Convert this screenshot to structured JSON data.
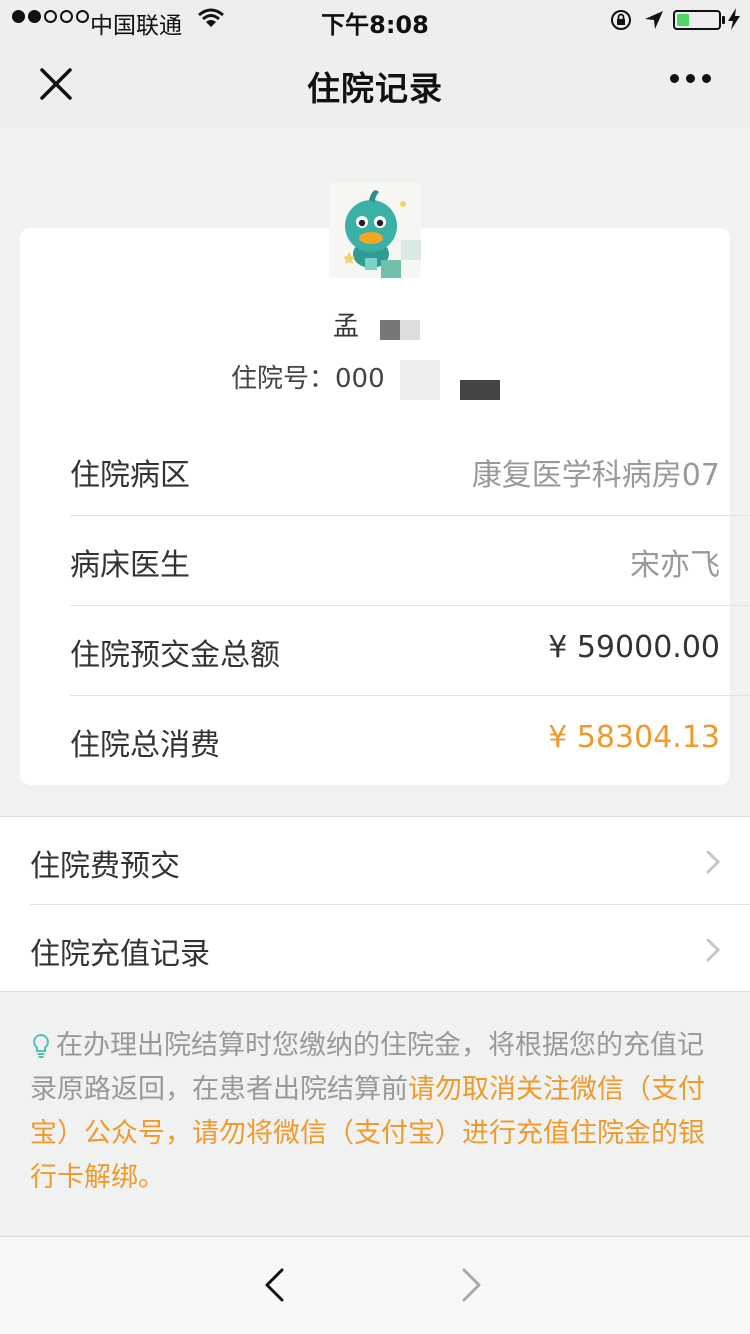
{
  "status_bar": {
    "carrier": "中国联通",
    "time": "下午8:08",
    "battery_level": 0.3
  },
  "nav": {
    "title": "住院记录"
  },
  "patient": {
    "name": "孟",
    "inpatient_label": "住院号：000"
  },
  "details": [
    {
      "label": "住院病区",
      "value": "康复医学科病房07"
    },
    {
      "label": "病床医生",
      "value": "宋亦飞"
    },
    {
      "label": "住院预交金总额",
      "value": "¥ 59000.00"
    },
    {
      "label": "住院总消费",
      "value": "¥ 58304.13"
    }
  ],
  "menu": [
    {
      "label": "住院费预交"
    },
    {
      "label": "住院充值记录"
    }
  ],
  "notice": {
    "normal_text": "在办理出院结算时您缴纳的住院金，将根据您的充值记录原路返回，在患者出院结算前",
    "warning_text": "请勿取消关注微信（支付宝）公众号，请勿将微信（支付宝）进行充值住院金的银行卡解绑。"
  },
  "colors": {
    "accent_orange": "#f09a2b",
    "notice_icon": "#4fc1b5"
  }
}
